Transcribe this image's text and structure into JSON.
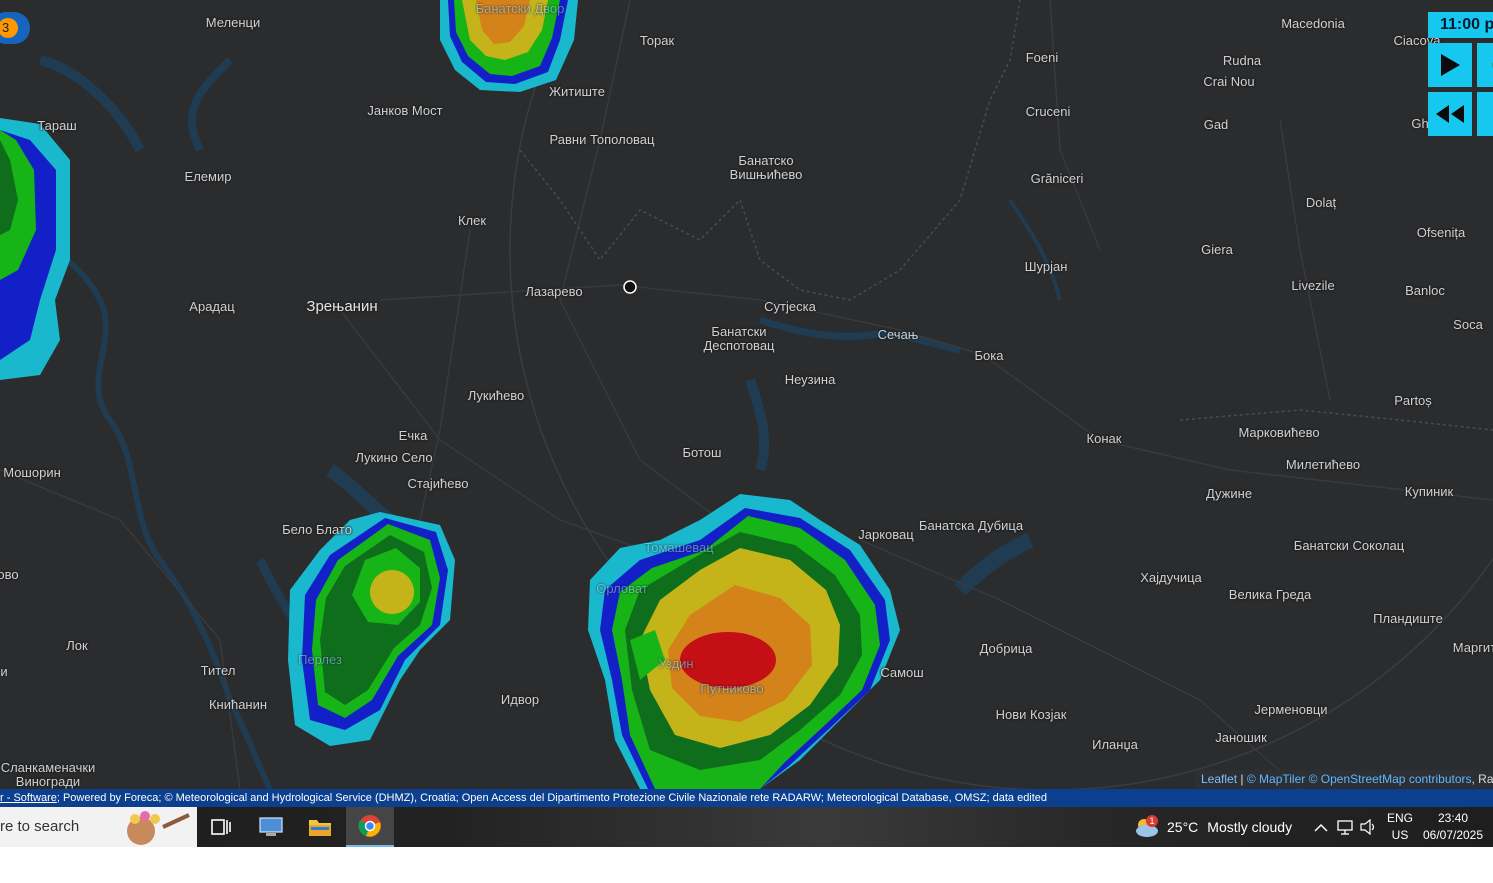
{
  "map": {
    "places": [
      {
        "name": "Меленци",
        "cls": ""
      },
      {
        "name": "Банатски Двор",
        "cls": "dim"
      },
      {
        "name": "Торак",
        "cls": ""
      },
      {
        "name": "Житиште",
        "cls": ""
      },
      {
        "name": "Јанков Мост",
        "cls": ""
      },
      {
        "name": "Тараш",
        "cls": ""
      },
      {
        "name": "Равни Тополовац",
        "cls": ""
      },
      {
        "name": "Банатско\nВишњићево",
        "cls": ""
      },
      {
        "name": "Елемир",
        "cls": ""
      },
      {
        "name": "Клек",
        "cls": ""
      },
      {
        "name": "Лазарево",
        "cls": ""
      },
      {
        "name": "Арадац",
        "cls": ""
      },
      {
        "name": "Зрењанин",
        "cls": "city"
      },
      {
        "name": "Сутјеска",
        "cls": ""
      },
      {
        "name": "Банатски\nДеспотовац",
        "cls": ""
      },
      {
        "name": "Сечањ",
        "cls": ""
      },
      {
        "name": "Бока",
        "cls": ""
      },
      {
        "name": "Неузина",
        "cls": ""
      },
      {
        "name": "Лукићево",
        "cls": ""
      },
      {
        "name": "Ечка",
        "cls": ""
      },
      {
        "name": "Лукино Село",
        "cls": ""
      },
      {
        "name": "Мошорин",
        "cls": ""
      },
      {
        "name": "Стајићево",
        "cls": ""
      },
      {
        "name": "Ботош",
        "cls": ""
      },
      {
        "name": "Бело Блато",
        "cls": ""
      },
      {
        "name": "Томашевац",
        "cls": "dim"
      },
      {
        "name": "Орловат",
        "cls": "dim"
      },
      {
        "name": "Јарковац",
        "cls": ""
      },
      {
        "name": "Банатска Дубица",
        "cls": ""
      },
      {
        "name": "Перлез",
        "cls": "dim"
      },
      {
        "name": "Лок",
        "cls": ""
      },
      {
        "name": "Тител",
        "cls": ""
      },
      {
        "name": "Уздин",
        "cls": "dim"
      },
      {
        "name": "Путниково",
        "cls": "dim"
      },
      {
        "name": "Самош",
        "cls": ""
      },
      {
        "name": "Добрица",
        "cls": ""
      },
      {
        "name": "Книћанин",
        "cls": ""
      },
      {
        "name": "Идвор",
        "cls": ""
      },
      {
        "name": "Нови Козјак",
        "cls": ""
      },
      {
        "name": "Иланџа",
        "cls": ""
      },
      {
        "name": "Сланкаменачки\nВиногради",
        "cls": ""
      },
      {
        "name": "Foeni",
        "cls": ""
      },
      {
        "name": "Cruceni",
        "cls": ""
      },
      {
        "name": "Grăniceri",
        "cls": ""
      },
      {
        "name": "Шурјан",
        "cls": ""
      },
      {
        "name": "Macedonia",
        "cls": ""
      },
      {
        "name": "Ciacova",
        "cls": ""
      },
      {
        "name": "Rudna",
        "cls": ""
      },
      {
        "name": "Crai Nou",
        "cls": ""
      },
      {
        "name": "Gad",
        "cls": ""
      },
      {
        "name": "Dolaț",
        "cls": ""
      },
      {
        "name": "Giera",
        "cls": ""
      },
      {
        "name": "Ofsenița",
        "cls": ""
      },
      {
        "name": "Livezile",
        "cls": ""
      },
      {
        "name": "Banloc",
        "cls": ""
      },
      {
        "name": "Soca",
        "cls": ""
      },
      {
        "name": "Partoș",
        "cls": ""
      },
      {
        "name": "Конак",
        "cls": ""
      },
      {
        "name": "Марковићево",
        "cls": ""
      },
      {
        "name": "Милетићево",
        "cls": ""
      },
      {
        "name": "Купиник",
        "cls": ""
      },
      {
        "name": "Дужине",
        "cls": ""
      },
      {
        "name": "Банатски Соколац",
        "cls": ""
      },
      {
        "name": "Хајдучица",
        "cls": ""
      },
      {
        "name": "Велика Греда",
        "cls": ""
      },
      {
        "name": "Пландиште",
        "cls": ""
      },
      {
        "name": "Маргита",
        "cls": ""
      },
      {
        "name": "Јерменовци",
        "cls": ""
      },
      {
        "name": "Јаношик",
        "cls": ""
      },
      {
        "name": "Gh",
        "cls": ""
      },
      {
        "name": "ово",
        "cls": ""
      },
      {
        "name": "и",
        "cls": ""
      }
    ],
    "badge_count": "3",
    "colors": {
      "water": "#1e3e55",
      "land": "#2b2c2e",
      "radar_cyan": "#19b8cc",
      "radar_blue": "#1320c8",
      "radar_green": "#17b417",
      "radar_darkgreen": "#0e6e1c",
      "radar_yellow": "#c4b41a",
      "radar_orange": "#d4821a",
      "radar_red": "#c40f14"
    }
  },
  "player": {
    "time_label": "11:00 p",
    "play_icon": "play-icon",
    "rewind_icon": "rewind-icon"
  },
  "attribution": {
    "leaflet": "Leaflet",
    "separator": "|",
    "maptiler": "© MapTiler",
    "osm": "© OpenStreetMap contributors",
    "tail": ", Ra"
  },
  "credits": {
    "link": "r - Software",
    "text": "; Powered by Foreca; © Meteorological and Hydrological Service (DHMZ), Croatia; Open Access del Dipartimento Protezione Civile Nazionale rete RADARW; Meteorological Database, OMSZ; data edited"
  },
  "taskbar": {
    "search_text": "re to search",
    "weather_temp": "25°C",
    "weather_desc": "Mostly cloudy",
    "weather_badge": "1",
    "lang_top": "ENG",
    "lang_bottom": "US",
    "time": "23:40",
    "date": "06/07/2025"
  }
}
